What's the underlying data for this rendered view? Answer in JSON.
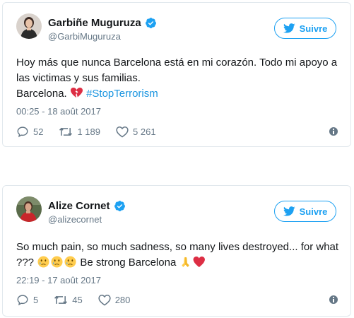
{
  "tweets": [
    {
      "author": {
        "display_name": "Garbiñe Muguruza",
        "handle": "@GarbiMuguruza",
        "verified": true
      },
      "follow_label": "Suivre",
      "text": {
        "line1": "Hoy más que nunca Barcelona está en mi corazón. Todo mi apoyo a las victimas y sus familias.",
        "line2_prefix": "Barcelona.",
        "emoji": "broken-heart",
        "hashtag": "#StopTerrorism"
      },
      "timestamp": "00:25 - 18 août 2017",
      "stats": {
        "replies": "52",
        "retweets": "1 189",
        "likes": "5 261"
      }
    },
    {
      "author": {
        "display_name": "Alize Cornet",
        "handle": "@alizecornet",
        "verified": true
      },
      "follow_label": "Suivre",
      "text": {
        "part1": "So much pain, so much sadness, so many lives destroyed... for what ???",
        "emojis_1": [
          "crying-face",
          "crying-face",
          "crying-face"
        ],
        "part2": "Be strong Barcelona",
        "emojis_2": [
          "folded-hands",
          "red-heart"
        ]
      },
      "timestamp": "22:19 - 17 août 2017",
      "stats": {
        "replies": "5",
        "retweets": "45",
        "likes": "280"
      }
    }
  ],
  "colors": {
    "accent": "#1da1f2",
    "hashtag": "#1b95e0",
    "muted": "#657786",
    "border": "#e1e8ed",
    "text": "#14171a"
  }
}
